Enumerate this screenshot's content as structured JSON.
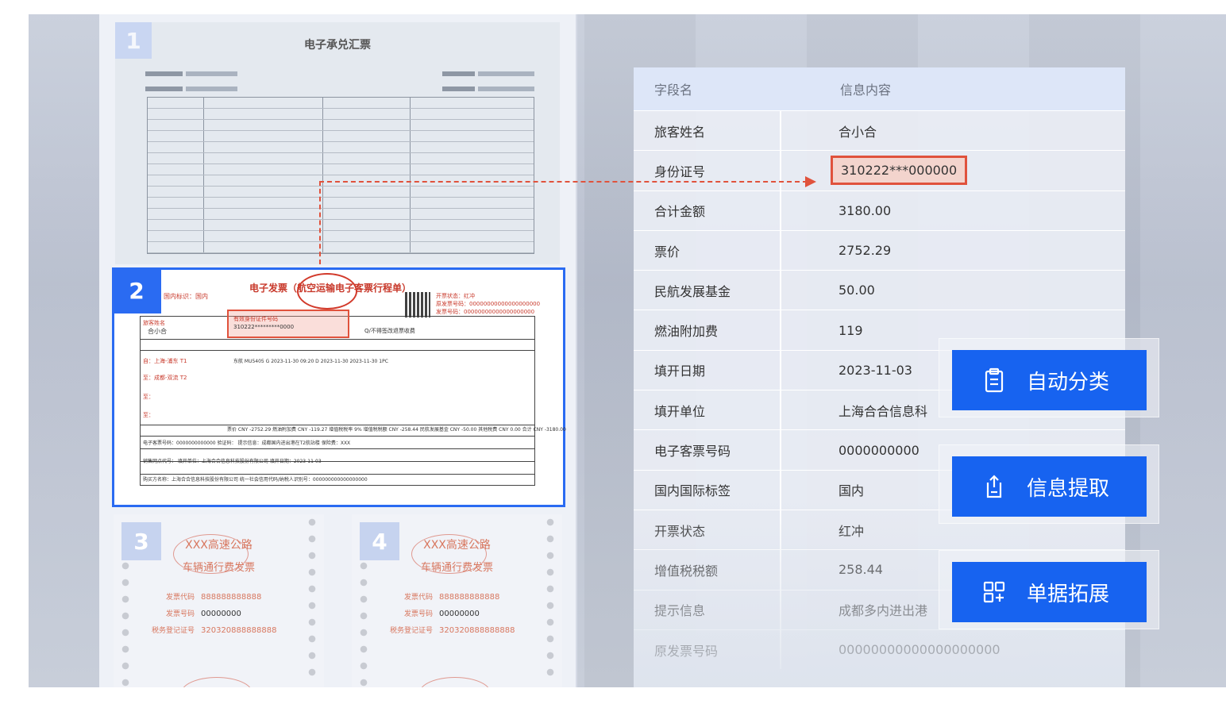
{
  "documents": {
    "doc1": {
      "number": "1",
      "title": "电子承兑汇票"
    },
    "doc2": {
      "number": "2",
      "title": "电子发票（航空运输电子客票行程单）",
      "sub": "国内标识：国内",
      "meta": [
        "开票状态：红冲",
        "原发票号码：00000000000000000000",
        "发票号码：00000000000000000000"
      ],
      "highlight_label": "有效身份证件号码",
      "highlight_value": "310222*********0000",
      "passenger_label": "旅客姓名",
      "passenger_name": "合小合",
      "remark": "Q/不得签改退票收费",
      "routes": [
        "自：上海-浦东 T1",
        "至：成都-双流 T2",
        "至：",
        "至："
      ],
      "flight_row": "东航   MU5405   G   2023-11-30   09:20   D   2023-11-30   2023-11-30   1PC",
      "fare_row": "票价 CNY -2752.29   燃油附加费 CNY -119.27   增值税税率 9%   增值税税额 CNY -258.44   民航发展基金 CNY -50.00   其他税费 CNY 0.00   合计 CNY -3180.00",
      "ticket_row": "电子客票号码：0000000000000   验证码：   提示信息：成都国内进出港在T2航站楼   保险费：XXX",
      "agent_row": "销售网点代号：   填开单位：上海合合信息科技股份有限公司   填开日期：2023-11-03",
      "buyer_row": "购买方名称：上海合合信息科技股份有限公司   统一社会信用代码/纳税人识别号：000000000000000000"
    },
    "toll": [
      {
        "number": "3",
        "title1": "XXX高速公路",
        "title2": "车辆通行费发票",
        "rows": [
          {
            "label": "发票代码",
            "value": "888888888888"
          },
          {
            "label": "发票号码",
            "value": "00000000"
          },
          {
            "label": "税务登记证号",
            "value": "320320888888888"
          }
        ]
      },
      {
        "number": "4",
        "title1": "XXX高速公路",
        "title2": "车辆通行费发票",
        "rows": [
          {
            "label": "发票代码",
            "value": "888888888888"
          },
          {
            "label": "发票号码",
            "value": "00000000"
          },
          {
            "label": "税务登记证号",
            "value": "320320888888888"
          }
        ]
      }
    ]
  },
  "table": {
    "header": {
      "field": "字段名",
      "content": "信息内容"
    },
    "rows": [
      {
        "field": "旅客姓名",
        "value": "合小合"
      },
      {
        "field": "身份证号",
        "value": "310222***000000"
      },
      {
        "field": "合计金额",
        "value": "3180.00"
      },
      {
        "field": "票价",
        "value": "2752.29"
      },
      {
        "field": "民航发展基金",
        "value": "50.00"
      },
      {
        "field": "燃油附加费",
        "value": "119"
      },
      {
        "field": "填开日期",
        "value": "2023-11-03"
      },
      {
        "field": "填开单位",
        "value": "上海合合信息科"
      },
      {
        "field": "电子客票号码",
        "value": "0000000000"
      },
      {
        "field": "国内国际标签",
        "value": "国内"
      },
      {
        "field": "开票状态",
        "value": "红冲"
      },
      {
        "field": "增值税税额",
        "value": "258.44"
      },
      {
        "field": "提示信息",
        "value": "成都多内进出港"
      },
      {
        "field": "原发票号码",
        "value": "00000000000000000000"
      }
    ]
  },
  "actions": [
    {
      "label": "自动分类",
      "icon": "clipboard-icon"
    },
    {
      "label": "信息提取",
      "icon": "upload-document-icon"
    },
    {
      "label": "单据拓展",
      "icon": "grid-plus-icon"
    }
  ],
  "colors": {
    "accent": "#1763f0",
    "highlight": "#e0523c",
    "selected_border": "#2a6bf2"
  }
}
